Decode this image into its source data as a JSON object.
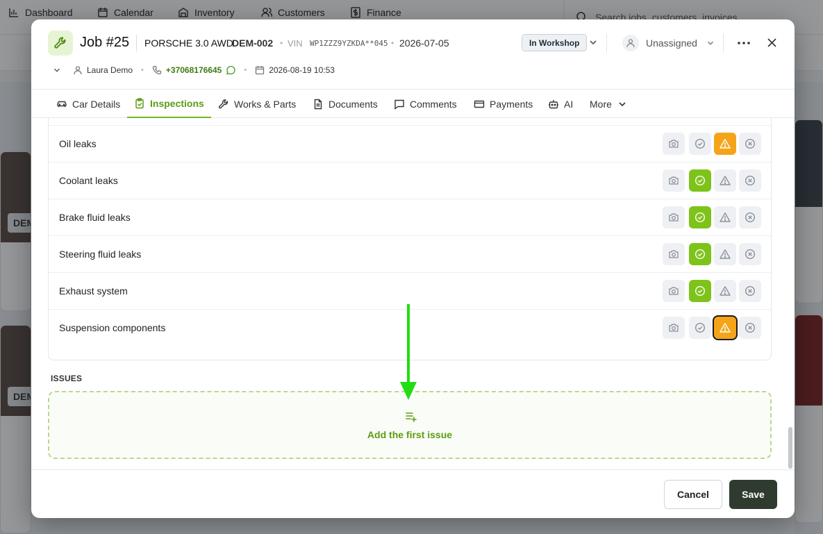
{
  "background": {
    "nav": [
      "Dashboard",
      "Calendar",
      "Inventory",
      "Customers",
      "Finance"
    ],
    "search_placeholder": "Search jobs, customers, invoices..."
  },
  "header": {
    "job_title": "Job #25",
    "car_model": "PORSCHE 3.0 AWD",
    "plate": "DEM-002",
    "vin_label": "VIN",
    "vin": "WP1ZZZ9YZKDA**045",
    "date": "2026-07-05",
    "status": "In Workshop",
    "assignee": "Unassigned",
    "customer": "Laura Demo",
    "phone": "+37068176645",
    "appointment": "2026-08-19 10:53"
  },
  "tabs": [
    {
      "label": "Car Details"
    },
    {
      "label": "Inspections"
    },
    {
      "label": "Works & Parts"
    },
    {
      "label": "Documents"
    },
    {
      "label": "Comments"
    },
    {
      "label": "Payments"
    },
    {
      "label": "AI"
    },
    {
      "label": "More"
    }
  ],
  "inspection_items": [
    {
      "label": "Oil leaks",
      "state": "warning"
    },
    {
      "label": "Coolant leaks",
      "state": "ok"
    },
    {
      "label": "Brake fluid leaks",
      "state": "ok"
    },
    {
      "label": "Steering fluid leaks",
      "state": "ok"
    },
    {
      "label": "Exhaust system",
      "state": "ok"
    },
    {
      "label": "Suspension components",
      "state": "warning"
    }
  ],
  "issues": {
    "title": "ISSUES",
    "add_label": "Add the first issue"
  },
  "footer": {
    "cancel_label": "Cancel",
    "save_label": "Save"
  },
  "colors": {
    "accent": "#78b41c",
    "ok": "#7ec31a",
    "warning": "#f5a419",
    "save": "#2f3b2e",
    "arrow": "#22dd11"
  }
}
